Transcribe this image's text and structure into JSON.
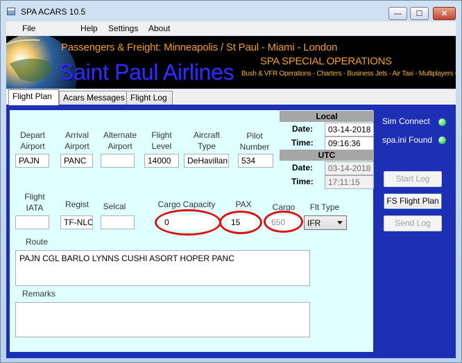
{
  "window": {
    "title": "SPA ACARS 10.5",
    "minimize_glyph": "—",
    "maximize_glyph": "☐",
    "close_glyph": "✕"
  },
  "menu": [
    "File",
    "Help",
    "Settings",
    "About"
  ],
  "banner": {
    "route": "Passengers & Freight: Minneapolis / St Paul - Miami - London",
    "airline": "Saint Paul Airlines",
    "special": "SPA SPECIAL OPERATIONS",
    "services": "Bush & VFR Operations - Charters - Business Jets - Air Taxi - Multiplayers Online"
  },
  "tabs": [
    {
      "label": "Flight Plan",
      "active": true
    },
    {
      "label": "Acars Messages",
      "active": false
    },
    {
      "label": "Flight Log",
      "active": false
    }
  ],
  "form": {
    "depart": {
      "label": "Depart Airport",
      "value": "PAJN"
    },
    "arrival": {
      "label": "Arrival Airport",
      "value": "PANC"
    },
    "alternate": {
      "label": "Alternate Airport",
      "value": ""
    },
    "level": {
      "label": "Flight Level",
      "value": "14000"
    },
    "aircraft": {
      "label": "Aircraft Type",
      "value": "DeHavillan"
    },
    "pilot": {
      "label": "Pilot Number",
      "value": "534"
    },
    "iata": {
      "label": "Flight IATA",
      "value": ""
    },
    "regist": {
      "label": "Regist",
      "value": "TF-NLC"
    },
    "selcal": {
      "label": "Selcal",
      "value": ""
    },
    "cargo_capacity": {
      "label": "Cargo Capacity",
      "value": "0"
    },
    "pax": {
      "label": "PAX",
      "value": "15"
    },
    "cargo": {
      "label": "Cargo",
      "value": "650"
    },
    "flt_type": {
      "label": "Flt Type",
      "value": "IFR"
    },
    "route": {
      "label": "Route",
      "value": "PAJN CGL BARLO LYNNS CUSHI ASORT HOPER PANC"
    },
    "remarks": {
      "label": "Remarks",
      "value": ""
    }
  },
  "time": {
    "local_header": "Local",
    "utc_header": "UTC",
    "date_label": "Date:",
    "time_label": "Time:",
    "local_date": "03-14-2018",
    "local_time": "09:16:36",
    "utc_date": "03-14-2018",
    "utc_time": "17:11:15"
  },
  "side": {
    "sim_connect": "Sim Connect",
    "spa_ini": "spa.ini Found",
    "start_log": "Start Log",
    "fs_flight_plan": "FS Flight Plan",
    "send_log": "Send Log"
  },
  "colors": {
    "panel_blue": "#1c2fb5",
    "form_bg": "#e0ffff",
    "highlight_red": "#d11111",
    "status_green": "#39c75a"
  }
}
